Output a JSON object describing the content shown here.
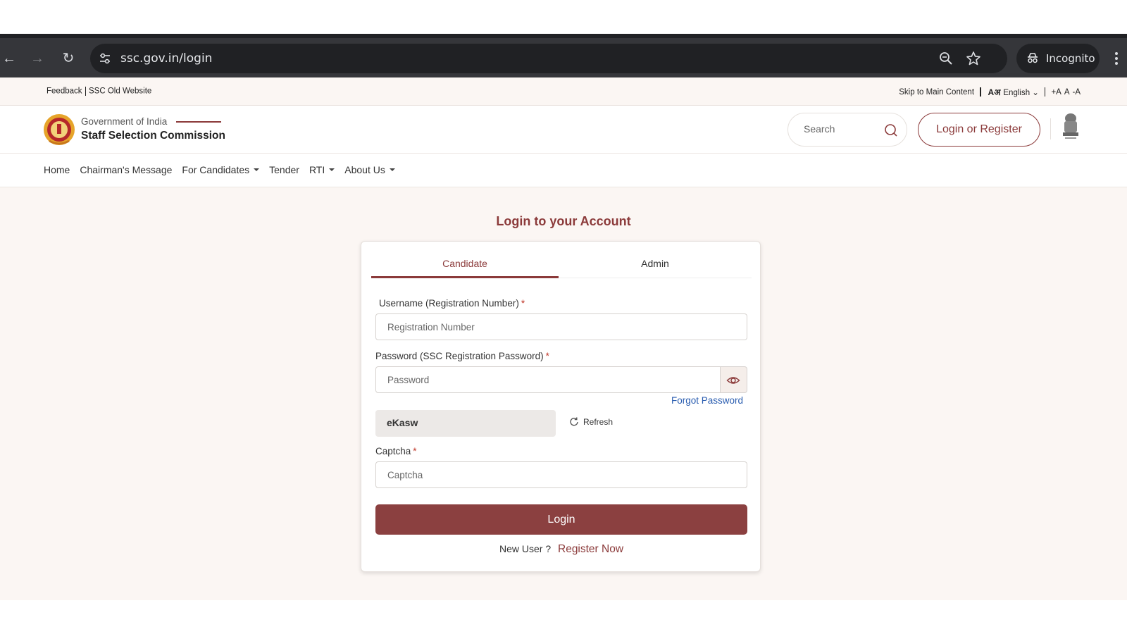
{
  "browser": {
    "url": "ssc.gov.in/login",
    "incognito_label": "Incognito",
    "icons": [
      "back-icon",
      "forward-icon",
      "reload-icon",
      "site-settings-icon",
      "zoom-icon",
      "bookmark-star-icon",
      "incognito-icon",
      "menu-kebab-icon"
    ]
  },
  "utility_bar": {
    "feedback": "Feedback",
    "old_website": "SSC Old Website",
    "skip": "Skip to Main Content",
    "lang_glyph": "Aअ",
    "language": "English",
    "font_plus": "+A",
    "font_normal": "A",
    "font_minus": "-A"
  },
  "header": {
    "gov": "Government of India",
    "org": "Staff Selection Commission",
    "search_placeholder": "Search",
    "login_register": "Login or Register"
  },
  "menu": {
    "items": [
      {
        "label": "Home"
      },
      {
        "label": "Chairman's Message"
      },
      {
        "label": "For Candidates"
      },
      {
        "label": "Tender"
      },
      {
        "label": "RTI"
      },
      {
        "label": "About Us"
      }
    ]
  },
  "login": {
    "title": "Login to your Account",
    "tabs": [
      "Candidate",
      "Admin"
    ],
    "username_label": "Username (Registration Number)",
    "username_placeholder": "Registration Number",
    "password_label": "Password (SSC Registration Password)",
    "password_placeholder": "Password",
    "forgot": "Forgot Password",
    "captcha_text": "eKasw",
    "refresh": "Refresh",
    "captcha_label": "Captcha",
    "captcha_placeholder": "Captcha",
    "required_mark": "*",
    "login_button": "Login",
    "new_user": "New User ?",
    "register_now": "Register Now"
  },
  "colors": {
    "brand": "#8b3a3a",
    "page_bg": "#fbf6f3",
    "link_blue": "#2a5db0"
  }
}
